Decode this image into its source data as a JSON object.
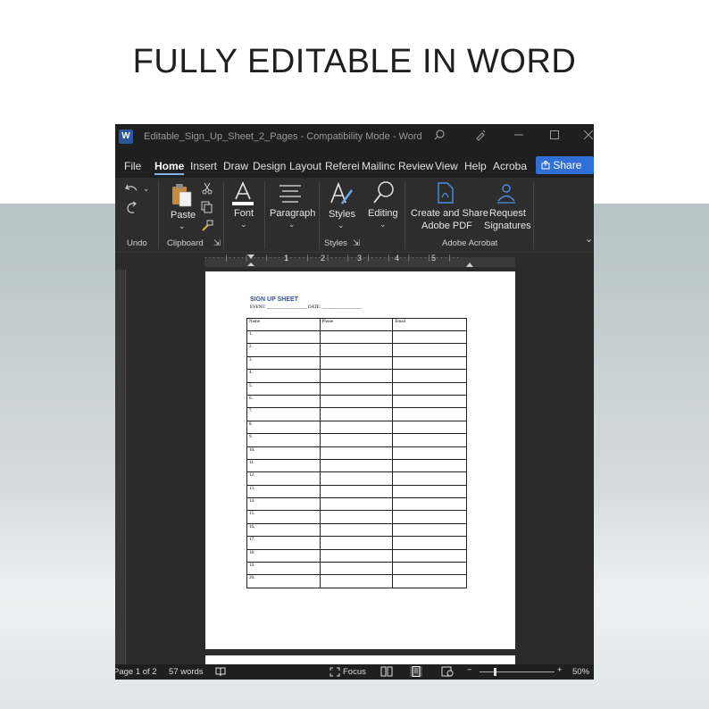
{
  "headline": "FULLY EDITABLE IN WORD",
  "window": {
    "app_badge": "W",
    "title": "Editable_Sign_Up_Sheet_2_Pages  -  Compatibility Mode  -  Word"
  },
  "tabs": [
    {
      "label": "File"
    },
    {
      "label": "Home"
    },
    {
      "label": "Insert"
    },
    {
      "label": "Draw"
    },
    {
      "label": "Design"
    },
    {
      "label": "Layout"
    },
    {
      "label": "Referei"
    },
    {
      "label": "Mailinc"
    },
    {
      "label": "Review"
    },
    {
      "label": "View"
    },
    {
      "label": "Help"
    },
    {
      "label": "Acroba"
    }
  ],
  "share_label": "Share",
  "ribbon": {
    "undo_group": "Undo",
    "paste": "Paste",
    "clipboard_group": "Clipboard",
    "font": "Font",
    "paragraph": "Paragraph",
    "styles": "Styles",
    "styles_group": "Styles",
    "editing": "Editing",
    "create_share_line1": "Create and Share",
    "create_share_line2": "Adobe PDF",
    "request_line1": "Request",
    "request_line2": "Signatures",
    "acrobat_group": "Adobe Acrobat"
  },
  "ruler_numbers": [
    "1",
    "2",
    "3",
    "4",
    "5"
  ],
  "document": {
    "title": "SIGN UP SHEET",
    "event_line": "EVENT: __________________     DATE: __________________",
    "columns": [
      "Name",
      "Phone",
      "Email"
    ],
    "rows": [
      "1.",
      "2.",
      "3.",
      "4.",
      "5.",
      "6.",
      "7.",
      "8.",
      "9.",
      "10.",
      "11.",
      "12.",
      "13.",
      "14.",
      "15.",
      "16.",
      "17.",
      "18.",
      "19.",
      "20."
    ]
  },
  "status": {
    "page": "Page 1 of 2",
    "words": "57 words",
    "focus": "Focus",
    "zoom": "50%"
  },
  "colors": {
    "accent_blue": "#2f6fd6",
    "title_blue": "#2f5496",
    "dark_bg": "#2b2b2b"
  }
}
